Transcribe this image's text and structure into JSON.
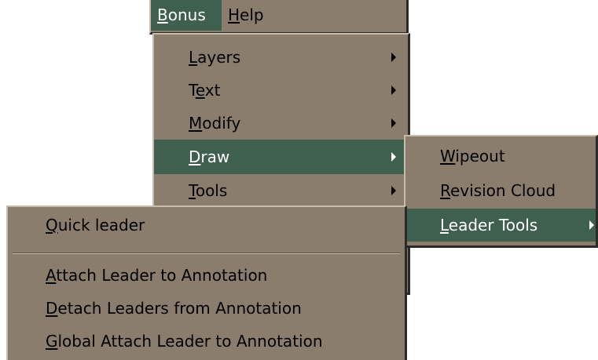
{
  "menubar": {
    "items": [
      {
        "label": "Bonus",
        "mnemonic": "B",
        "rest": "onus",
        "active": true
      },
      {
        "label": "Help",
        "mnemonic": "H",
        "rest": "elp",
        "active": false
      }
    ]
  },
  "bonus_menu": {
    "items": [
      {
        "pre": "",
        "mnemonic": "L",
        "post": "ayers",
        "submenu": true
      },
      {
        "pre": "T",
        "mnemonic": "e",
        "post": "xt",
        "submenu": true
      },
      {
        "pre": "",
        "mnemonic": "M",
        "post": "odify",
        "submenu": true
      },
      {
        "pre": "",
        "mnemonic": "D",
        "post": "raw",
        "submenu": true,
        "highlighted": true
      },
      {
        "pre": "",
        "mnemonic": "T",
        "post": "ools",
        "submenu": true
      }
    ]
  },
  "draw_menu": {
    "items": [
      {
        "pre": "",
        "mnemonic": "W",
        "post": "ipeout",
        "submenu": false
      },
      {
        "pre": "",
        "mnemonic": "R",
        "post": "evision Cloud",
        "submenu": false
      },
      {
        "pre": "",
        "mnemonic": "L",
        "post": "eader Tools",
        "submenu": true,
        "highlighted": true
      }
    ]
  },
  "leader_menu": {
    "items": [
      {
        "pre": "",
        "mnemonic": "Q",
        "post": "uick leader"
      },
      {
        "pre": "",
        "mnemonic": "A",
        "post": "ttach Leader to Annotation"
      },
      {
        "pre": "",
        "mnemonic": "D",
        "post": "etach Leaders from Annotation"
      },
      {
        "pre": "",
        "mnemonic": "G",
        "post": "lobal Attach Leader to Annotation"
      }
    ]
  },
  "colors": {
    "menu_bg": "#8b7d6e",
    "highlight_bg": "#3f5f4f",
    "highlight_text": "#ffffff"
  }
}
